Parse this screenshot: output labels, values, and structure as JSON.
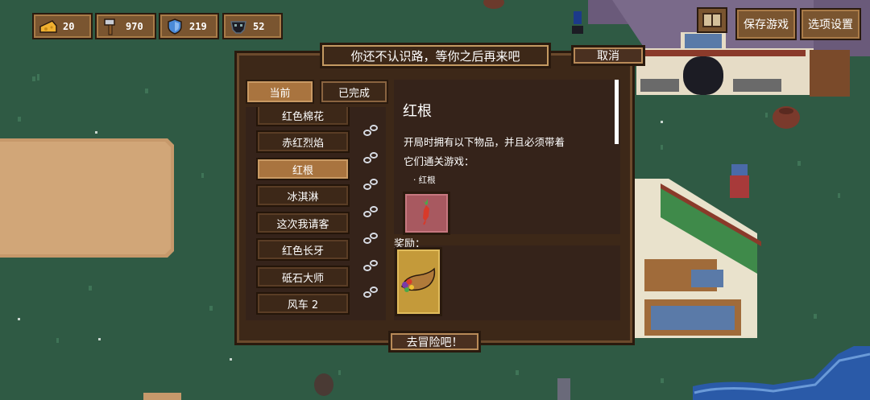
{
  "hud": {
    "resources": [
      {
        "icon": "cheese-icon",
        "value": "20"
      },
      {
        "icon": "hammer-icon",
        "value": "970"
      },
      {
        "icon": "shield-icon",
        "value": "219"
      },
      {
        "icon": "skull-mask-icon",
        "value": "52"
      }
    ],
    "save_label": "保存游戏",
    "settings_label": "选项设置"
  },
  "dialog": {
    "title": "你还不认识路，等你之后再来吧",
    "cancel_label": "取消",
    "tabs": [
      {
        "label": "当前",
        "active": true
      },
      {
        "label": "已完成",
        "active": false
      }
    ],
    "quests": [
      {
        "label": "红色棉花",
        "selected": false
      },
      {
        "label": "赤红烈焰",
        "selected": false
      },
      {
        "label": "红根",
        "selected": true
      },
      {
        "label": "冰淇淋",
        "selected": false
      },
      {
        "label": "这次我请客",
        "selected": false
      },
      {
        "label": "红色长牙",
        "selected": false
      },
      {
        "label": "砥石大师",
        "selected": false
      },
      {
        "label": "风车 2",
        "selected": false
      }
    ],
    "detail": {
      "name": "红根",
      "description_line1": "开局时拥有以下物品，并且必须带着",
      "description_line2": "它们通关游戏：",
      "required_item": "· 红根",
      "reward_label": "奖励："
    },
    "go_label": "去冒险吧！"
  },
  "colors": {
    "grass": "#2f5a44",
    "panel": "#3d2818",
    "button": "#7a5530",
    "selected": "#a9743f"
  }
}
